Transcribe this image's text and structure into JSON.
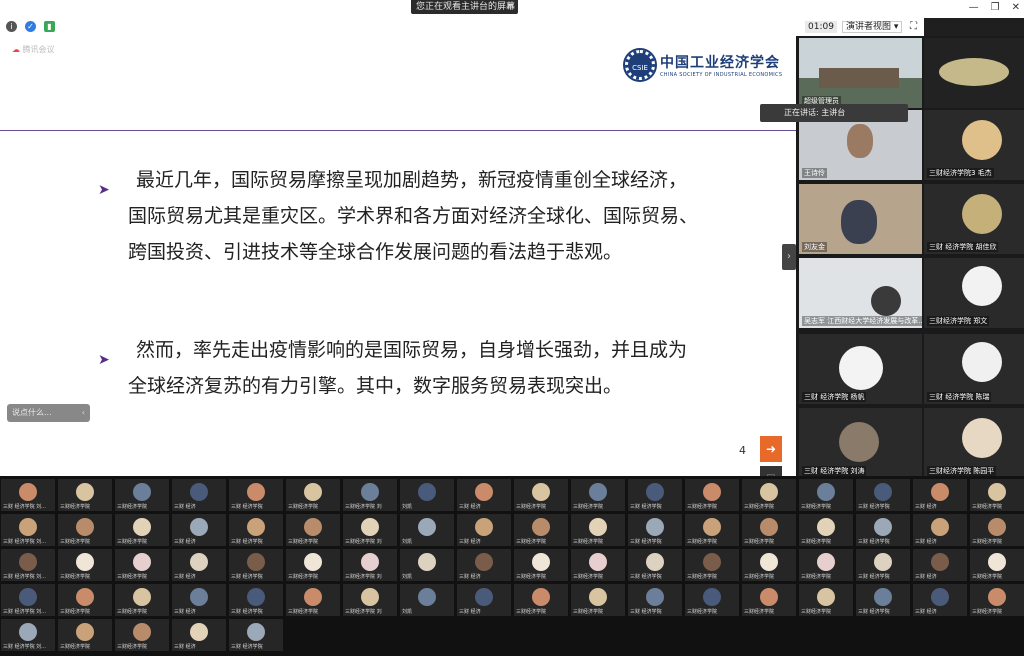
{
  "app": {
    "banner_text": "您正在观看主讲台的屏幕",
    "banner_icon": "≡",
    "timer": "01:09",
    "view_selector": "演讲者视图 ▾",
    "fullscreen_icon": "⛶",
    "window_controls": [
      "—",
      "❐",
      "✕"
    ]
  },
  "slide": {
    "tag": "腾讯会议",
    "logo_text": "中国工业经济学会",
    "logo_subtext": "CHINA SOCIETY OF INDUSTRIAL ECONOMICS",
    "logo_badge": "CSIE",
    "bullet_symbol": "➤",
    "paragraph1": "最近几年，国际贸易摩擦呈现加剧趋势，新冠疫情重创全球经济，国际贸易尤其是重灾区。学术界和各方面对经济全球化、国际贸易、跨国投资、引进技术等全球合作发展问题的看法趋于悲观。",
    "paragraph2": "然而，率先走出疫情影响的是国际贸易，自身增长强劲，并且成为全球经济复苏的有力引擎。其中，数字服务贸易表现突出。",
    "page_number": "4"
  },
  "chat": {
    "placeholder": "说点什么...",
    "close": "‹"
  },
  "speaking": {
    "text": "正在讲话: 主讲台"
  },
  "right_tiles": [
    {
      "name": "超级管理员"
    },
    {
      "name": ""
    },
    {
      "name": "王诗伶"
    },
    {
      "name": "三财经济学院3 毛杰"
    },
    {
      "name": "刘友金"
    },
    {
      "name": "三财 经济学院 胡佳欣"
    },
    {
      "name": "吴志军 江西财经大学经济发展与改革..."
    },
    {
      "name": "三财经济学院 郑文"
    },
    {
      "name": "三财 经济学院 杨帆"
    },
    {
      "name": "三财 经济学院 陈瑞"
    },
    {
      "name": "三财 经济学院 刘涛"
    },
    {
      "name": "三财经济学院 陈园平"
    }
  ],
  "gallery": [
    {
      "name": "三财 经济学院 刘..."
    },
    {
      "name": "三财经济学院"
    },
    {
      "name": "三财经济学院"
    },
    {
      "name": "三财 经济"
    },
    {
      "name": "三财 经济学院"
    },
    {
      "name": "三财经济学院"
    },
    {
      "name": "三财经济学院 刘"
    },
    {
      "name": "刘凯"
    },
    {
      "name": "三财 经济"
    },
    {
      "name": "三财经济学院"
    },
    {
      "name": "三财经济学院"
    },
    {
      "name": "三财 经济学院"
    },
    {
      "name": "三财经济学院"
    },
    {
      "name": "三财经济学院"
    },
    {
      "name": "三财经济学院"
    },
    {
      "name": "三财 经济学院"
    },
    {
      "name": "三财 经济"
    },
    {
      "name": "三财经济学院"
    }
  ],
  "colors": {
    "slide_accent": "#6a4d93",
    "logo_blue": "#1e3e7a",
    "share_orange": "#e86a2b"
  }
}
